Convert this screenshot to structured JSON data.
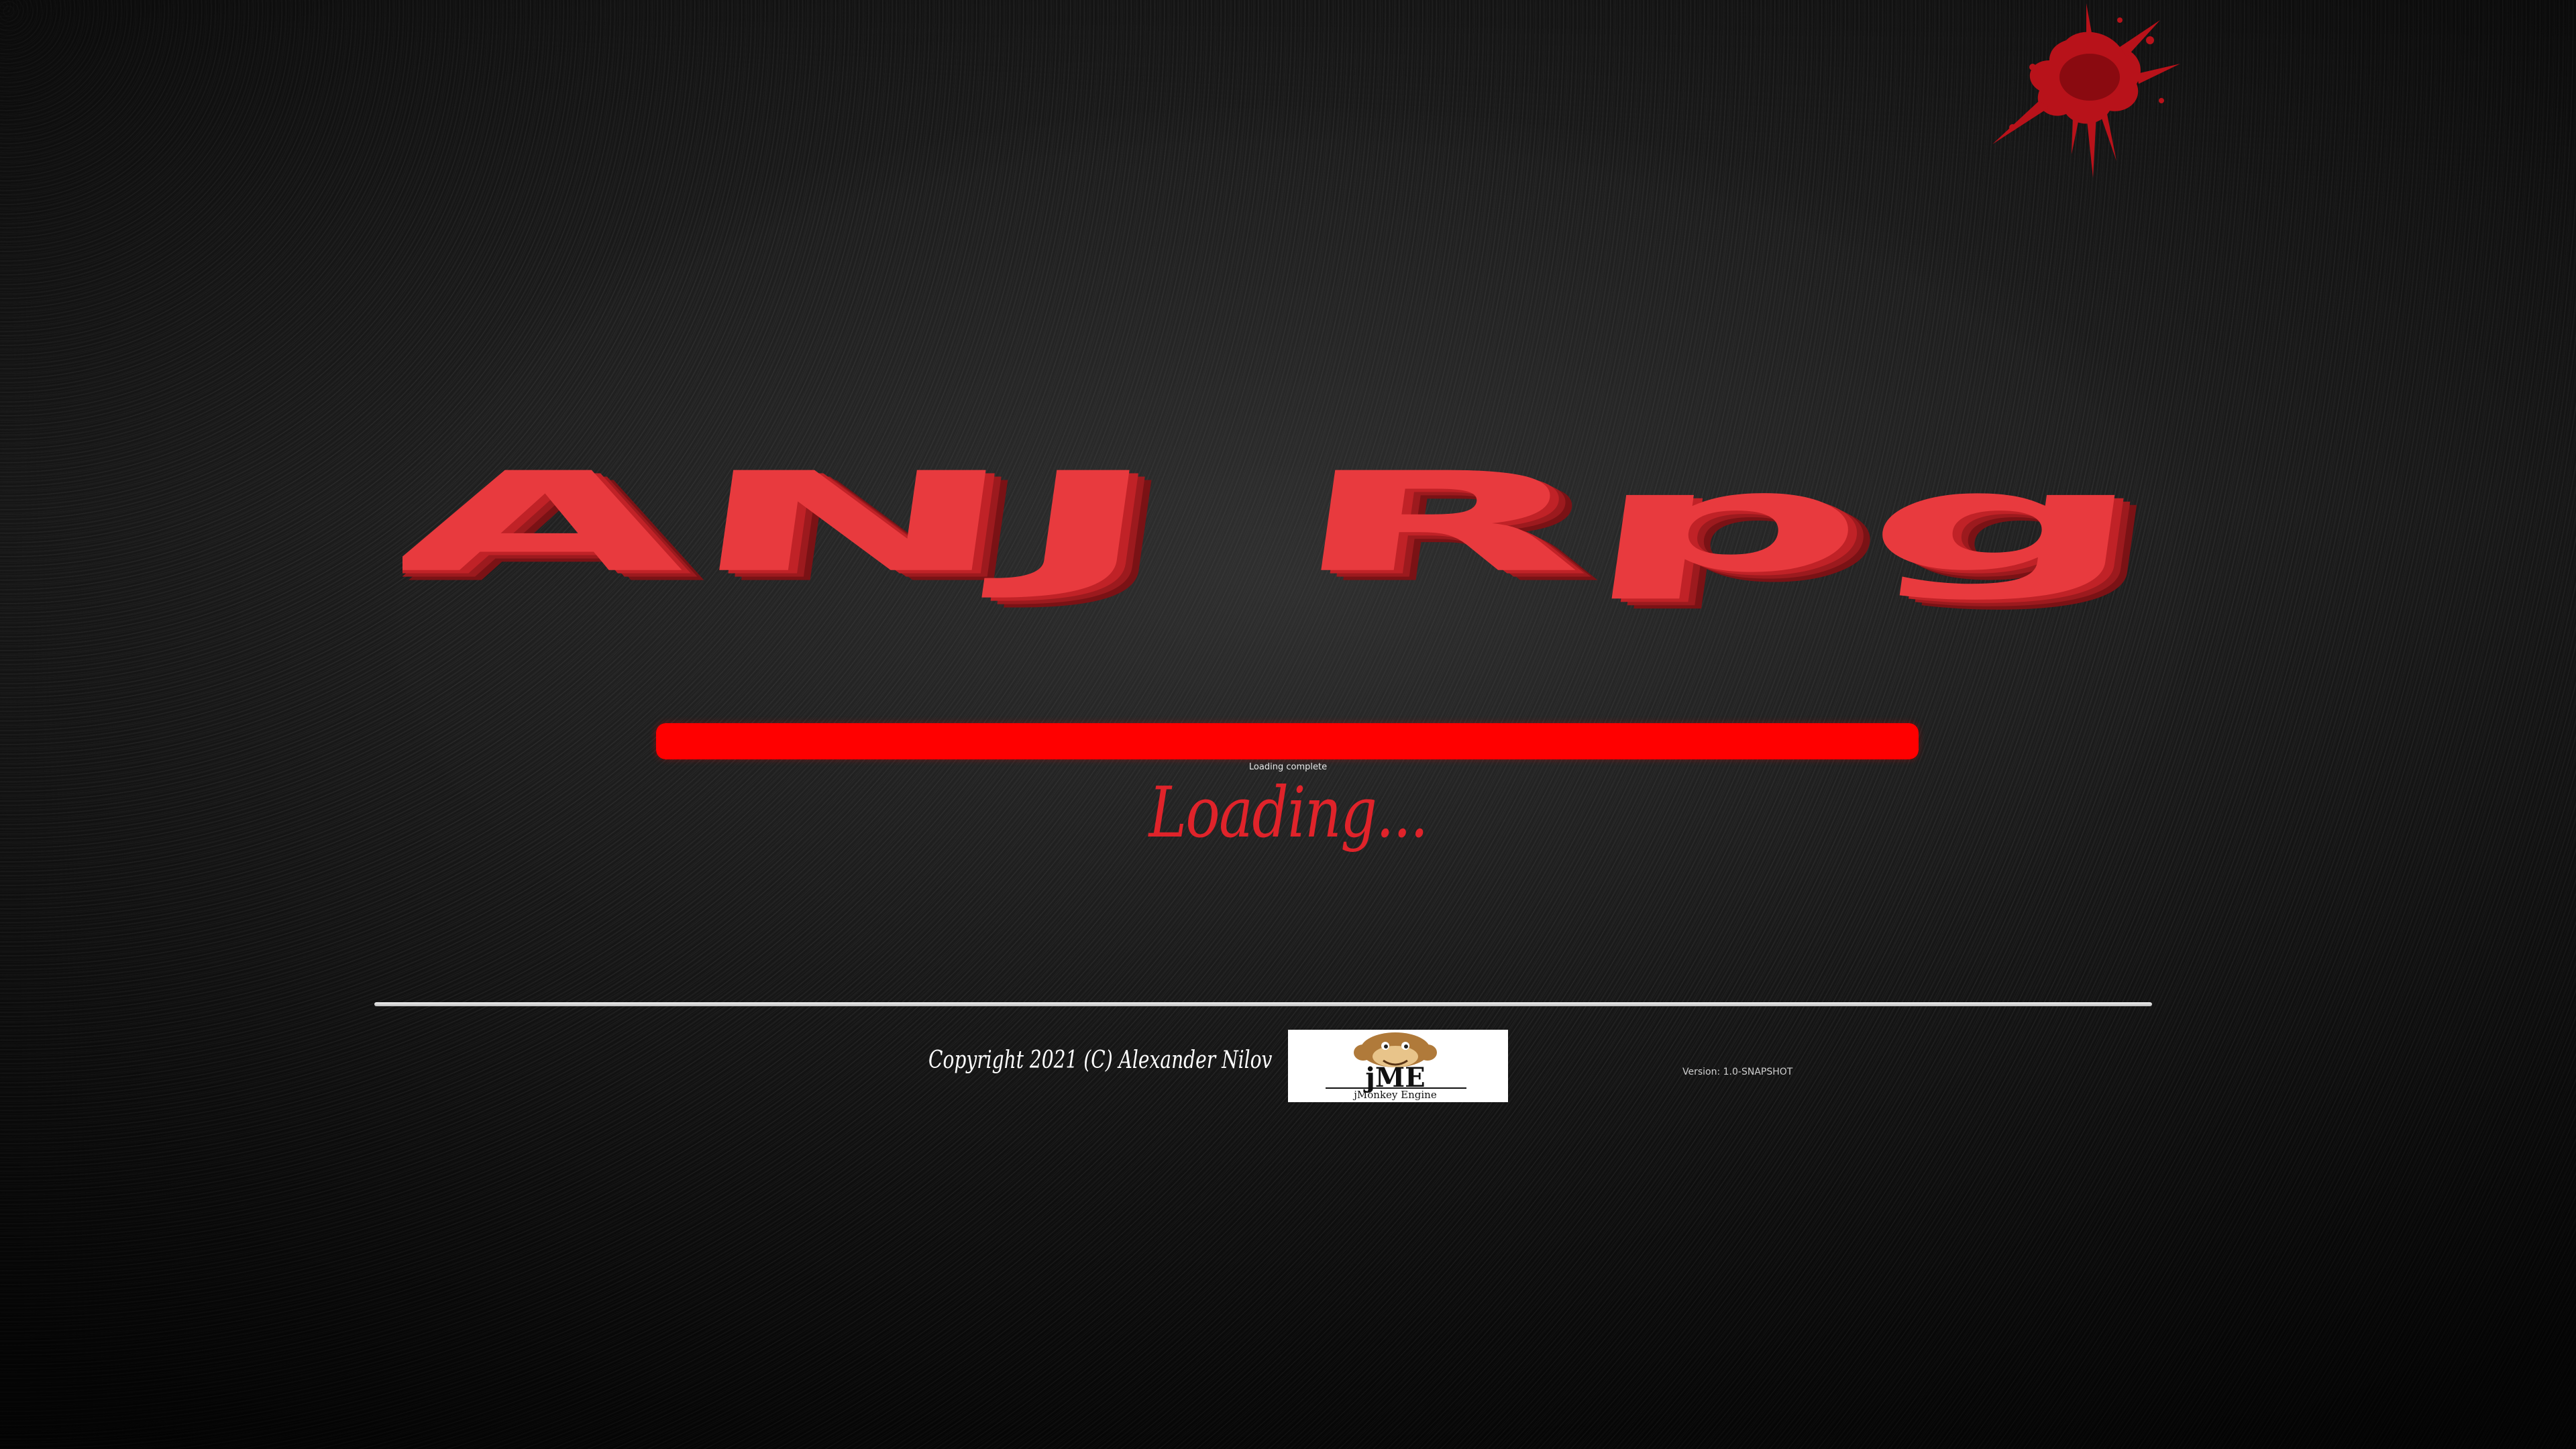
{
  "game": {
    "title": "ANJ Rpg",
    "title_color": "#e83a3e"
  },
  "loading": {
    "progress": 1.0,
    "bar_color": "#ff0000",
    "status": "Loading complete",
    "label": "Loading..."
  },
  "footer": {
    "copyright": "Copyright 2021 (C) Alexander Nilov",
    "engine_logo": {
      "name": "jme-logo-icon",
      "text": "jME",
      "subtext": "jMonkey Engine"
    },
    "version": "Version: 1.0-SNAPSHOT"
  },
  "decor": {
    "splat_color": "#c0121a",
    "background": "asphalt-texture"
  }
}
